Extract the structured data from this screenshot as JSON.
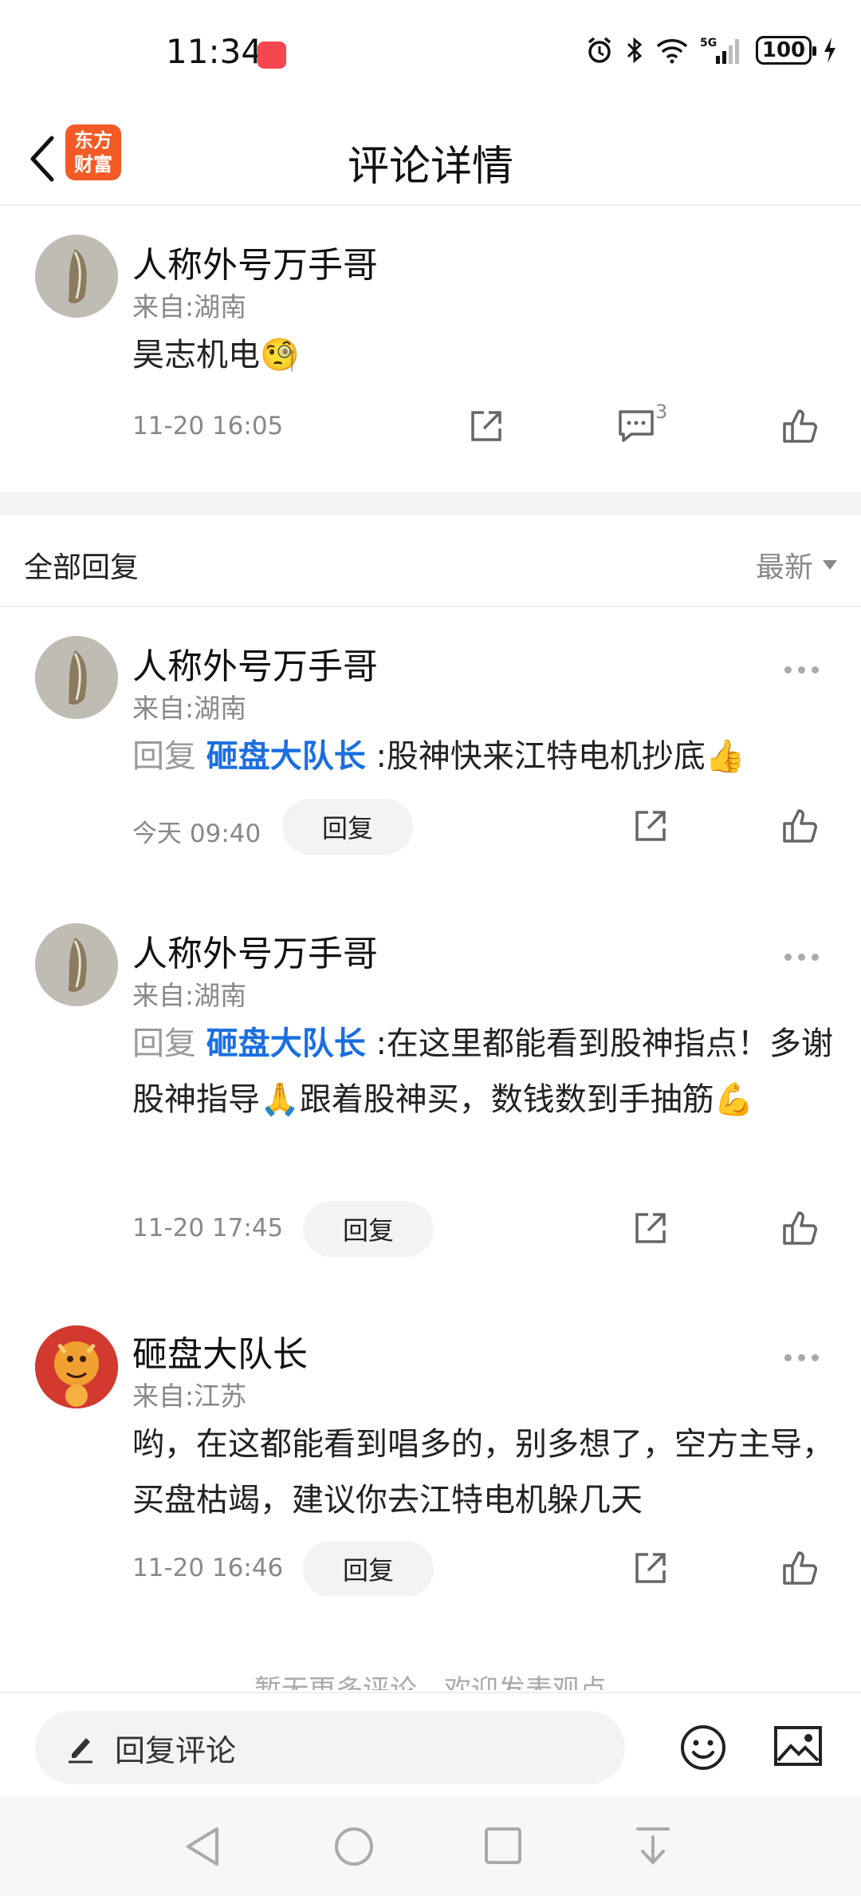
{
  "status_bar": {
    "time": "11:34",
    "battery": "100",
    "network": "5G"
  },
  "nav": {
    "title": "评论详情",
    "logo_line1": "东方",
    "logo_line2": "财富"
  },
  "main_comment": {
    "user": "人称外号万手哥",
    "from": "来自:湖南",
    "content": "昊志机电",
    "emoji": "🧐",
    "time": "11-20 16:05",
    "reply_count": "3"
  },
  "replies_header": {
    "title": "全部回复",
    "sort": "最新"
  },
  "replies": [
    {
      "user": "人称外号万手哥",
      "from": "来自:湖南",
      "prefix": "回复",
      "mention": "砸盘大队长",
      "text": ":股神快来江特电机抄底👍",
      "time": "今天 09:40",
      "reply_label": "回复"
    },
    {
      "user": "人称外号万手哥",
      "from": "来自:湖南",
      "prefix": "回复",
      "mention": "砸盘大队长",
      "text": ":在这里都能看到股神指点！多谢股神指导🙏跟着股神买，数钱数到手抽筋💪",
      "time": "11-20 17:45",
      "reply_label": "回复"
    },
    {
      "user": "砸盘大队长",
      "from": "来自:江苏",
      "prefix": "",
      "mention": "",
      "text": "哟，在这都能看到唱多的，别多想了，空方主导，买盘枯竭，建议你去江特电机躲几天",
      "time": "11-20 16:46",
      "reply_label": "回复"
    }
  ],
  "footer_hint": "暂无更多评论，欢迎发表观点",
  "input_bar": {
    "placeholder": "回复评论"
  },
  "colors": {
    "brand": "#f45a25",
    "mention": "#1a6ee0",
    "muted": "#888888"
  }
}
